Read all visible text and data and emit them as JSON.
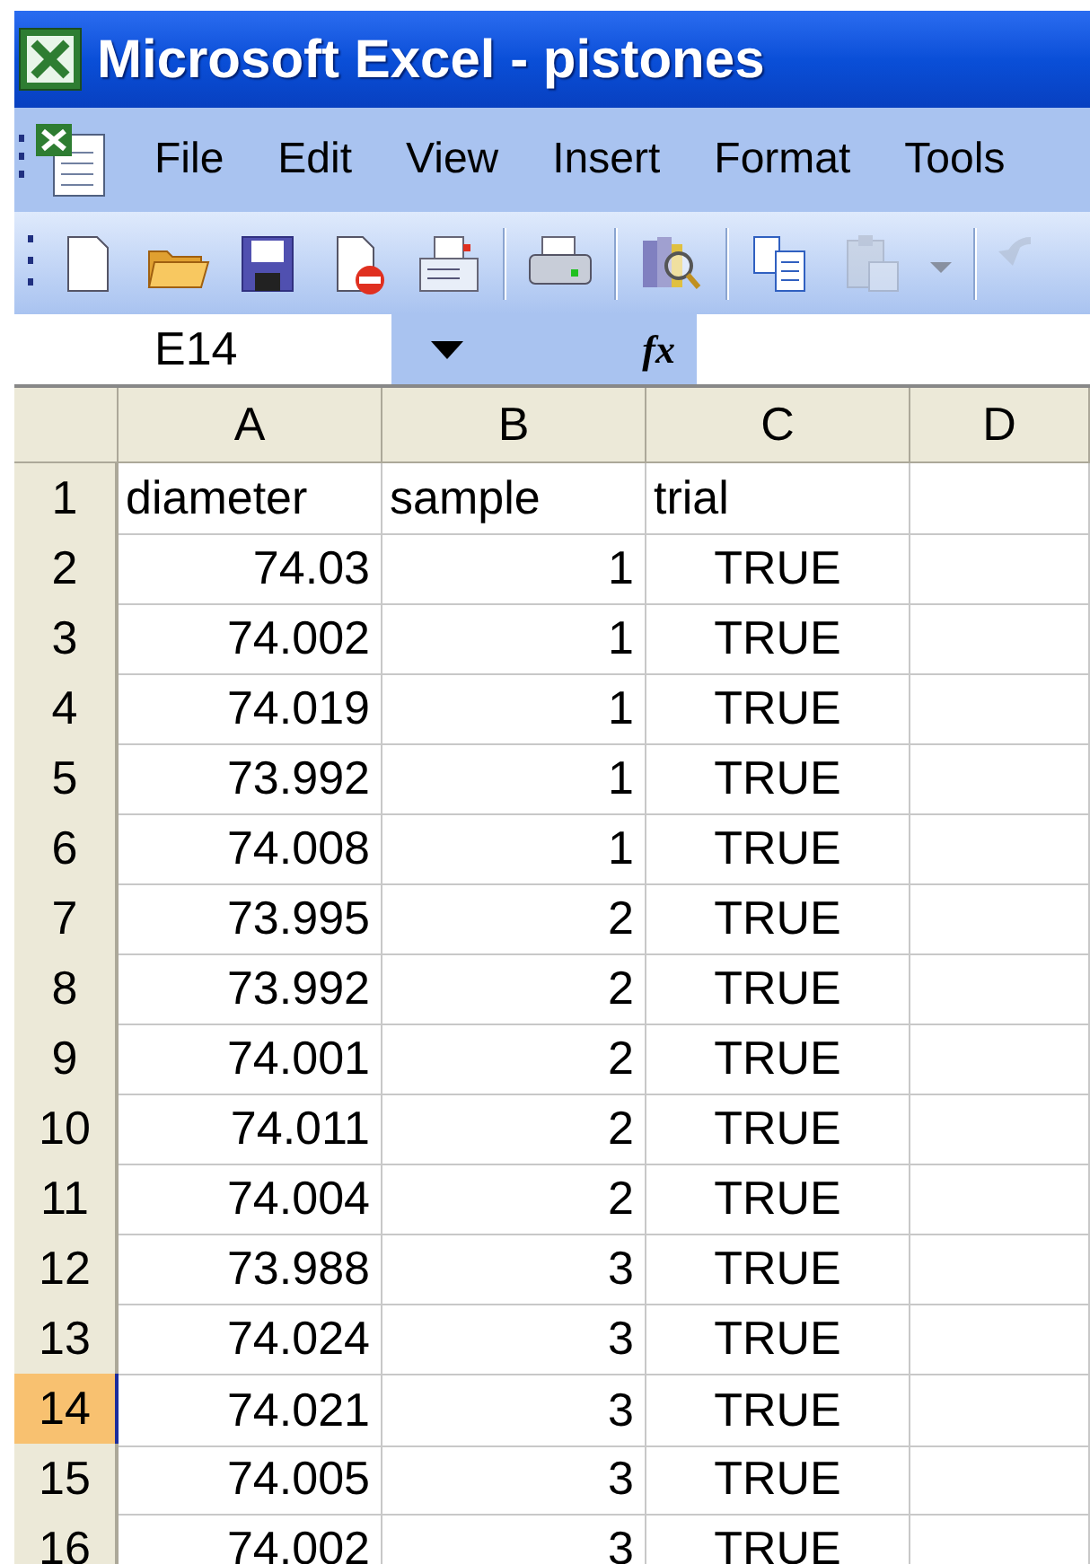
{
  "window": {
    "title": "Microsoft Excel - pistones"
  },
  "menu": [
    {
      "label": "File"
    },
    {
      "label": "Edit"
    },
    {
      "label": "View"
    },
    {
      "label": "Insert"
    },
    {
      "label": "Format"
    },
    {
      "label": "Tools"
    }
  ],
  "toolbar": [
    {
      "kind": "new",
      "disabled": false
    },
    {
      "kind": "open",
      "disabled": false
    },
    {
      "kind": "save",
      "disabled": false
    },
    {
      "kind": "permission",
      "disabled": false
    },
    {
      "kind": "mail",
      "disabled": false
    },
    {
      "kind": "separator"
    },
    {
      "kind": "print",
      "disabled": false
    },
    {
      "kind": "separator"
    },
    {
      "kind": "research",
      "disabled": false
    },
    {
      "kind": "separator"
    },
    {
      "kind": "copy",
      "disabled": false
    },
    {
      "kind": "paste",
      "disabled": true
    },
    {
      "kind": "dropdown",
      "disabled": false
    },
    {
      "kind": "separator"
    },
    {
      "kind": "undo",
      "disabled": true
    }
  ],
  "formula_bar": {
    "name_box": "E14",
    "fx": "fx"
  },
  "sheet": {
    "columns": [
      "A",
      "B",
      "C",
      "D"
    ],
    "rows": [
      {
        "header": "1",
        "selected": false,
        "cells": [
          {
            "text": "diameter",
            "kind": "text"
          },
          {
            "text": "sample",
            "kind": "text"
          },
          {
            "text": "trial",
            "kind": "text"
          }
        ]
      },
      {
        "header": "2",
        "selected": false,
        "cells": [
          {
            "text": "74.03",
            "kind": "number"
          },
          {
            "text": "1",
            "kind": "number"
          },
          {
            "text": "TRUE",
            "kind": "bool"
          }
        ]
      },
      {
        "header": "3",
        "selected": false,
        "cells": [
          {
            "text": "74.002",
            "kind": "number"
          },
          {
            "text": "1",
            "kind": "number"
          },
          {
            "text": "TRUE",
            "kind": "bool"
          }
        ]
      },
      {
        "header": "4",
        "selected": false,
        "cells": [
          {
            "text": "74.019",
            "kind": "number"
          },
          {
            "text": "1",
            "kind": "number"
          },
          {
            "text": "TRUE",
            "kind": "bool"
          }
        ]
      },
      {
        "header": "5",
        "selected": false,
        "cells": [
          {
            "text": "73.992",
            "kind": "number"
          },
          {
            "text": "1",
            "kind": "number"
          },
          {
            "text": "TRUE",
            "kind": "bool"
          }
        ]
      },
      {
        "header": "6",
        "selected": false,
        "cells": [
          {
            "text": "74.008",
            "kind": "number"
          },
          {
            "text": "1",
            "kind": "number"
          },
          {
            "text": "TRUE",
            "kind": "bool"
          }
        ]
      },
      {
        "header": "7",
        "selected": false,
        "cells": [
          {
            "text": "73.995",
            "kind": "number"
          },
          {
            "text": "2",
            "kind": "number"
          },
          {
            "text": "TRUE",
            "kind": "bool"
          }
        ]
      },
      {
        "header": "8",
        "selected": false,
        "cells": [
          {
            "text": "73.992",
            "kind": "number"
          },
          {
            "text": "2",
            "kind": "number"
          },
          {
            "text": "TRUE",
            "kind": "bool"
          }
        ]
      },
      {
        "header": "9",
        "selected": false,
        "cells": [
          {
            "text": "74.001",
            "kind": "number"
          },
          {
            "text": "2",
            "kind": "number"
          },
          {
            "text": "TRUE",
            "kind": "bool"
          }
        ]
      },
      {
        "header": "10",
        "selected": false,
        "cells": [
          {
            "text": "74.011",
            "kind": "number"
          },
          {
            "text": "2",
            "kind": "number"
          },
          {
            "text": "TRUE",
            "kind": "bool"
          }
        ]
      },
      {
        "header": "11",
        "selected": false,
        "cells": [
          {
            "text": "74.004",
            "kind": "number"
          },
          {
            "text": "2",
            "kind": "number"
          },
          {
            "text": "TRUE",
            "kind": "bool"
          }
        ]
      },
      {
        "header": "12",
        "selected": false,
        "cells": [
          {
            "text": "73.988",
            "kind": "number"
          },
          {
            "text": "3",
            "kind": "number"
          },
          {
            "text": "TRUE",
            "kind": "bool"
          }
        ]
      },
      {
        "header": "13",
        "selected": false,
        "cells": [
          {
            "text": "74.024",
            "kind": "number"
          },
          {
            "text": "3",
            "kind": "number"
          },
          {
            "text": "TRUE",
            "kind": "bool"
          }
        ]
      },
      {
        "header": "14",
        "selected": true,
        "cells": [
          {
            "text": "74.021",
            "kind": "number"
          },
          {
            "text": "3",
            "kind": "number"
          },
          {
            "text": "TRUE",
            "kind": "bool"
          }
        ]
      },
      {
        "header": "15",
        "selected": false,
        "cells": [
          {
            "text": "74.005",
            "kind": "number"
          },
          {
            "text": "3",
            "kind": "number"
          },
          {
            "text": "TRUE",
            "kind": "bool"
          }
        ]
      },
      {
        "header": "16",
        "selected": false,
        "cells": [
          {
            "text": "74.002",
            "kind": "number"
          },
          {
            "text": "3",
            "kind": "number"
          },
          {
            "text": "TRUE",
            "kind": "bool"
          }
        ]
      }
    ]
  }
}
